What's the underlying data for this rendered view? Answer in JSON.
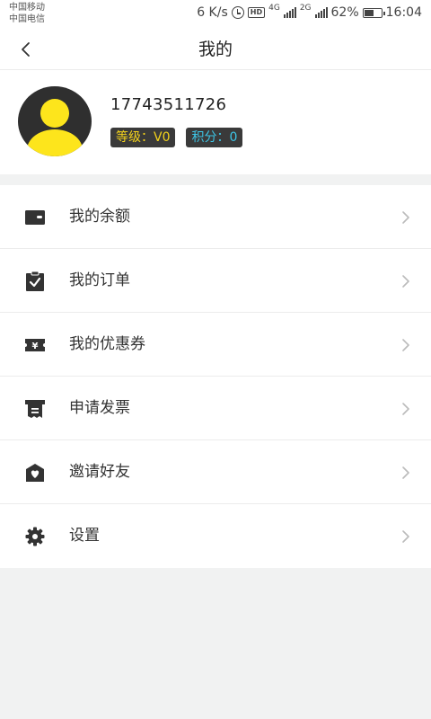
{
  "status_bar": {
    "carrier1": "中国移动",
    "carrier2": "中国电信",
    "speed": "6 K/s",
    "net1": "4G",
    "net2": "2G",
    "battery_percent": "62%",
    "battery_level": 0.62,
    "time": "16:04",
    "hd_label": "HD"
  },
  "nav": {
    "title": "我的",
    "back_icon": "chevron-left-icon"
  },
  "profile": {
    "phone": "17743511726",
    "level_label": "等级：V0",
    "points_label": "积分：0"
  },
  "menu": {
    "items": [
      {
        "label": "我的余额",
        "icon": "wallet-icon"
      },
      {
        "label": "我的订单",
        "icon": "order-clipboard-icon"
      },
      {
        "label": "我的优惠券",
        "icon": "coupon-icon"
      },
      {
        "label": "申请发票",
        "icon": "invoice-icon"
      },
      {
        "label": "邀请好友",
        "icon": "invite-heart-icon"
      },
      {
        "label": "设置",
        "icon": "gear-icon"
      }
    ]
  },
  "colors": {
    "accent_yellow": "#fde51c",
    "points_blue": "#3dc5e6",
    "level_yellow": "#f3d21b",
    "background": "#f1f2f2"
  }
}
